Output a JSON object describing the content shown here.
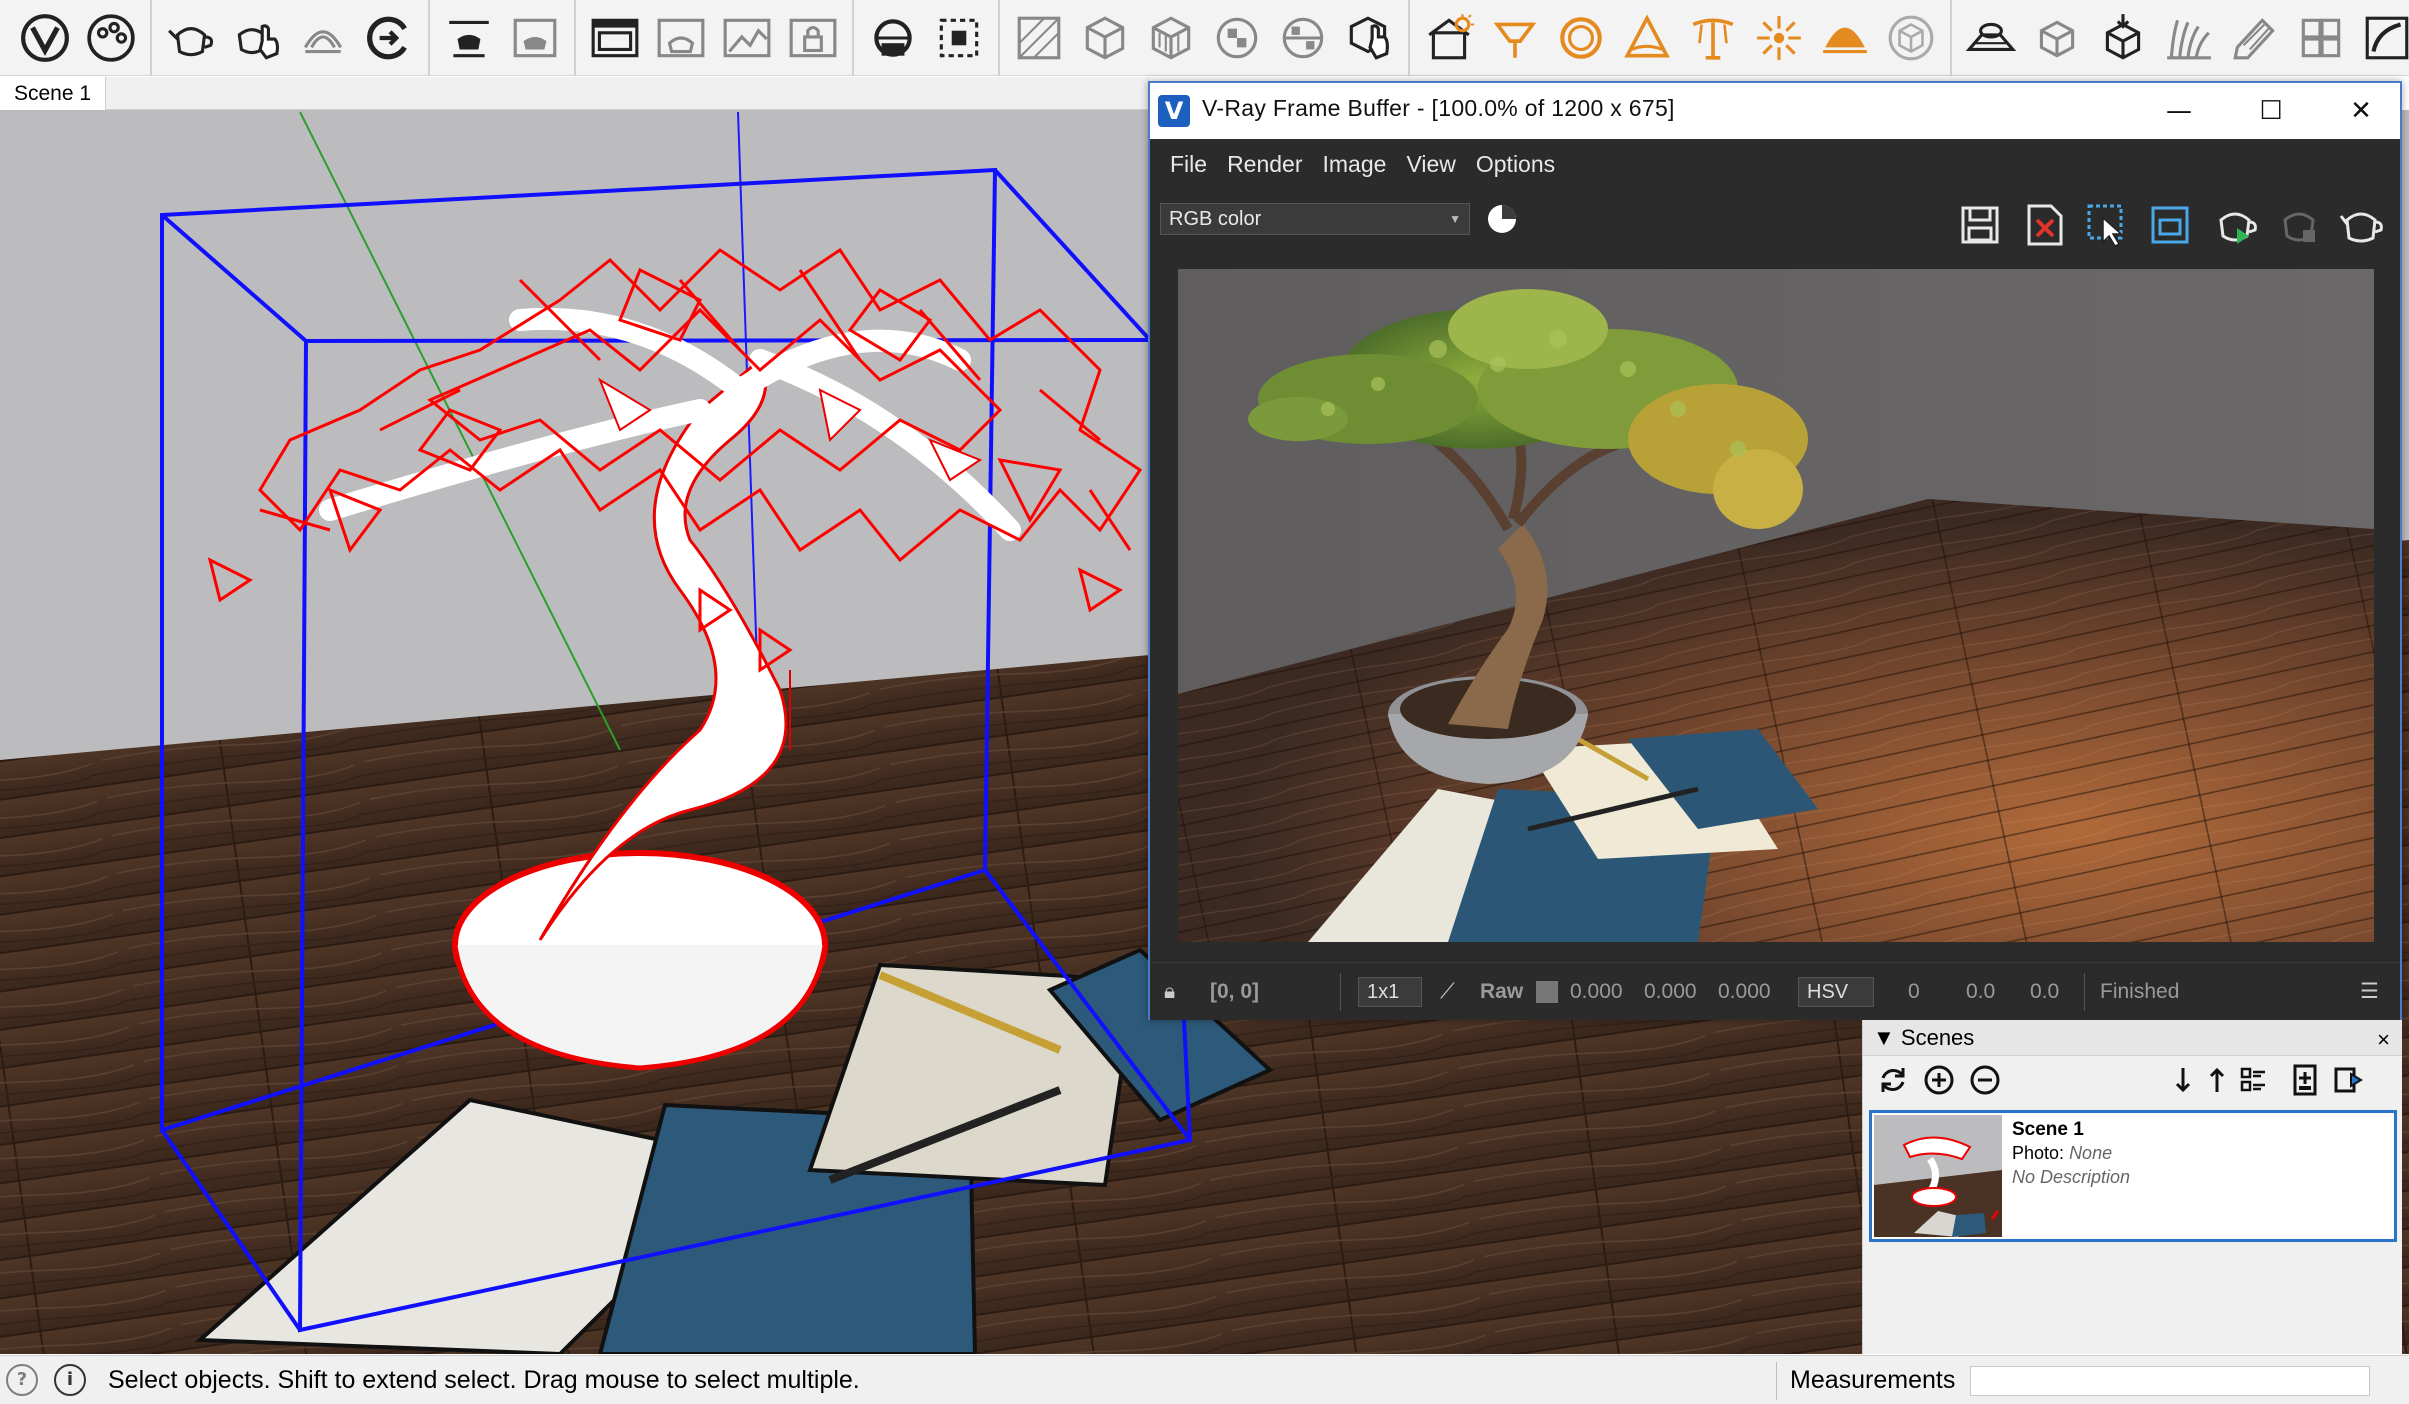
{
  "toolbar": {
    "icons": [
      "vray-logo-icon",
      "asset-editor-icon",
      "render-teapot-icon",
      "interactive-render-icon",
      "progressive-render-icon",
      "vfb-toggle-icon",
      "lights-gen-icon",
      "batch-render-icon",
      "frame-buffer-icon",
      "material-preview-icon",
      "render-region-icon",
      "lock-icon",
      "sphere-light-icon",
      "clipper-icon",
      "proxy-icon",
      "mesh-light-icon",
      "cube-light-icon",
      "checker-icon",
      "fur-icon",
      "object-properties-icon",
      "dome-light-icon",
      "spot-light-icon",
      "sphere-light2-icon",
      "ies-light-icon",
      "omni-light-icon",
      "sun-light-icon",
      "dome-icon",
      "cube-icon",
      "infinite-plane-icon",
      "proxy-export-icon",
      "proxy-import-icon",
      "fur-object-icon",
      "scatter-icon",
      "layers-icon",
      "section-icon"
    ]
  },
  "scene_tab": {
    "label": "Scene 1"
  },
  "vfb": {
    "title": "V-Ray Frame Buffer - [100.0% of 1200 x 675]",
    "logo": "V",
    "minimize": "—",
    "maximize": "☐",
    "close": "✕",
    "menu": [
      "File",
      "Render",
      "Image",
      "View",
      "Options"
    ],
    "channel": "RGB color",
    "tools": [
      "save-image-icon",
      "clear-image-icon",
      "region-render-icon",
      "track-mouse-icon",
      "render-icon",
      "stop-render-icon",
      "interactive-teapot-icon"
    ],
    "status": {
      "coords": "[0, 0]",
      "zoom": "1x1",
      "raw_label": "Raw",
      "r": "0.000",
      "g": "0.000",
      "b": "0.000",
      "color_model": "HSV",
      "h": "0",
      "s": "0.0",
      "v": "0.0",
      "state": "Finished"
    }
  },
  "scenes_panel": {
    "title": "Scenes",
    "collapse_glyph": "▼",
    "close": "×",
    "scene": {
      "name": "Scene 1",
      "photo_label": "Photo:",
      "photo_value": "None",
      "description": "No Description"
    }
  },
  "statusbar": {
    "text": "Select objects. Shift to extend select. Drag mouse to select multiple.",
    "measurements_label": "Measurements",
    "icon1": "?",
    "icon2": "i"
  },
  "colors": {
    "vray_blue": "#1d5fbf",
    "vray_orange": "#e58a1f",
    "selection_red": "#ff0000",
    "bbox_blue": "#1010ff",
    "vfb_bg": "#2b2b2b"
  }
}
